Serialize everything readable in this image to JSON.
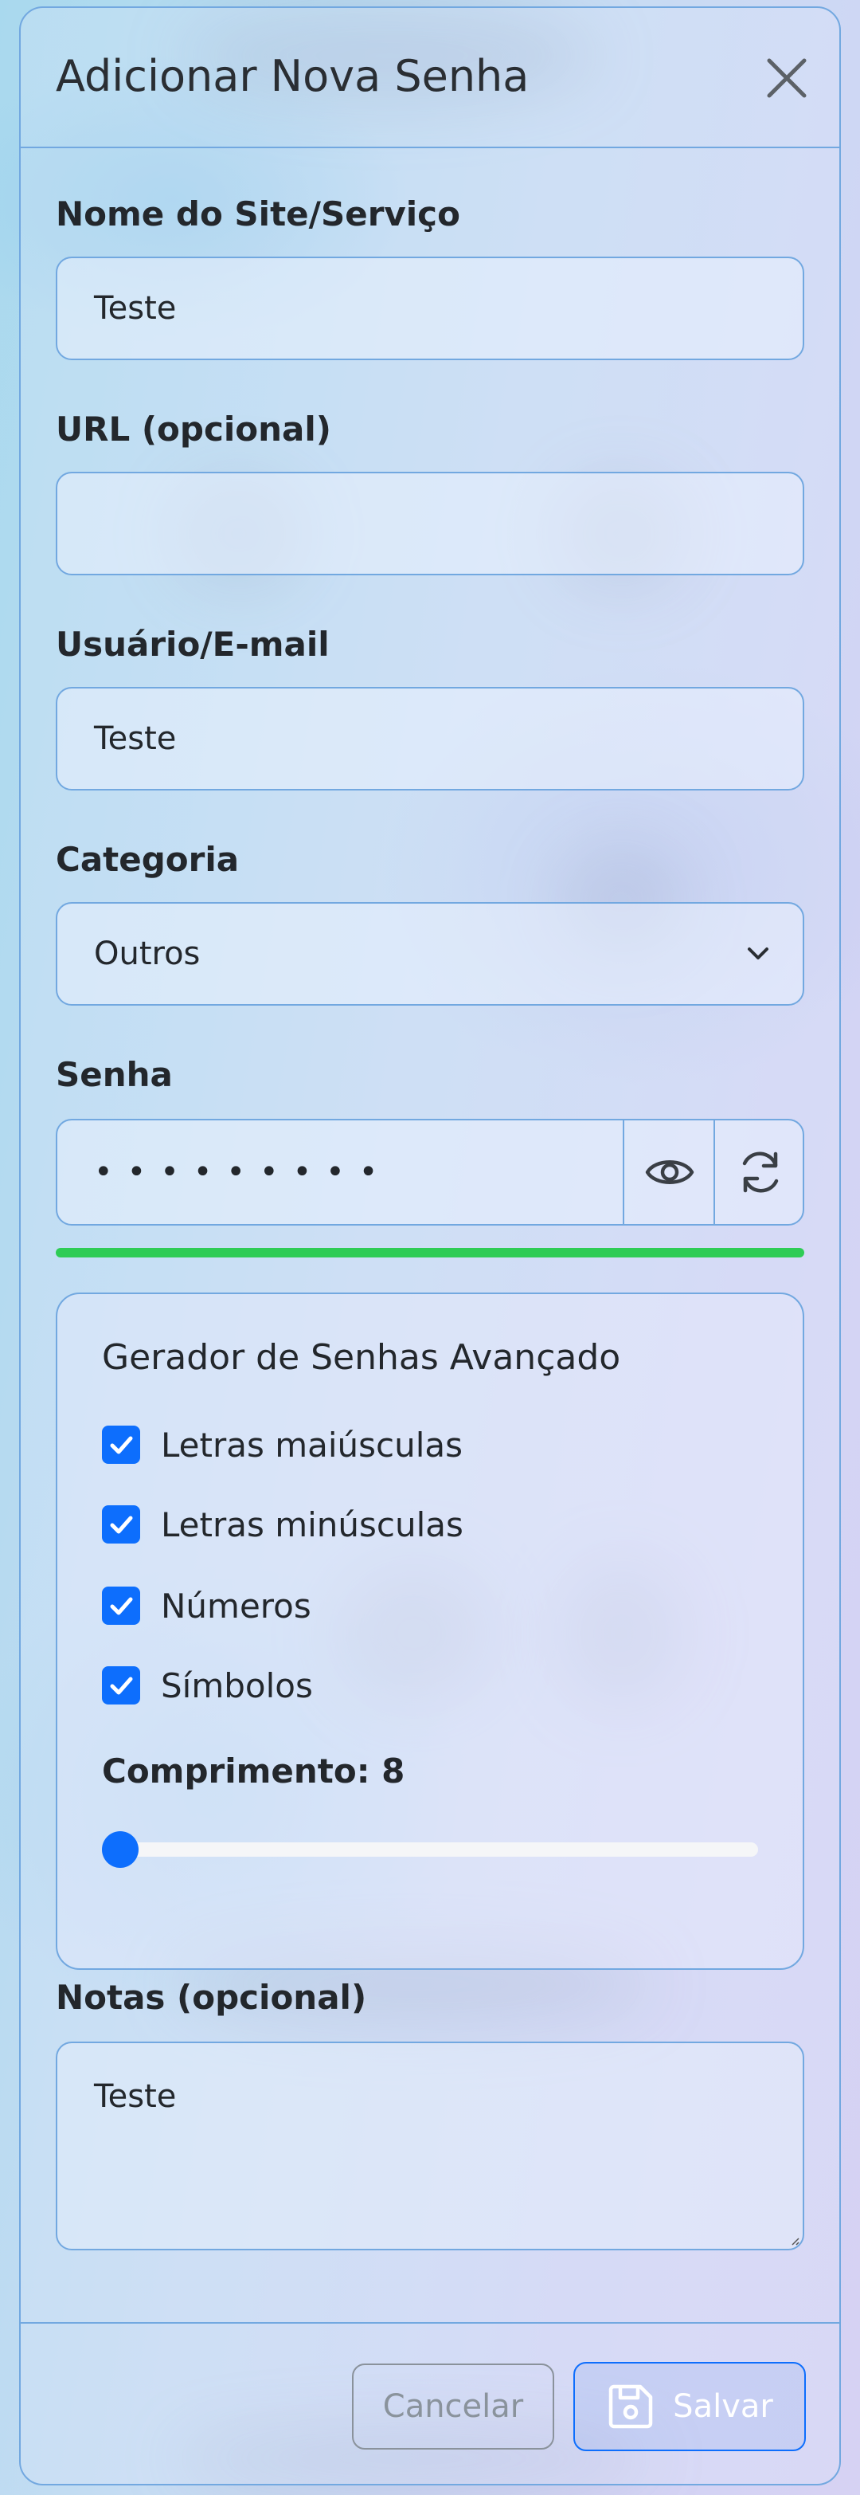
{
  "modal": {
    "title": "Adicionar Nova Senha"
  },
  "form": {
    "site": {
      "label": "Nome do Site/Serviço",
      "value": "Teste"
    },
    "url": {
      "label": "URL (opcional)",
      "value": ""
    },
    "user": {
      "label": "Usuário/E-mail",
      "value": "Teste"
    },
    "category": {
      "label": "Categoria",
      "value": "Outros"
    },
    "password": {
      "label": "Senha",
      "masked": "•••••••••",
      "strength_percent": 100
    },
    "notes": {
      "label": "Notas (opcional)",
      "value": "Teste"
    }
  },
  "generator": {
    "title": "Gerador de Senhas Avançado",
    "options": [
      {
        "label": "Letras maiúsculas",
        "checked": true
      },
      {
        "label": "Letras minúsculas",
        "checked": true
      },
      {
        "label": "Números",
        "checked": true
      },
      {
        "label": "Símbolos",
        "checked": true
      }
    ],
    "length_label": "Comprimento: 8",
    "length_value": 8,
    "length_fraction": 0
  },
  "footer": {
    "cancel_label": "Cancelar",
    "save_label": "Salvar"
  },
  "icons": {
    "close": "close-icon",
    "chevron": "chevron-down-icon",
    "eye": "eye-icon",
    "refresh": "refresh-icon",
    "save": "floppy-disk-icon"
  },
  "colors": {
    "accent": "#0d6efd",
    "border": "#72a8e0",
    "strength": "#2ecc55"
  }
}
